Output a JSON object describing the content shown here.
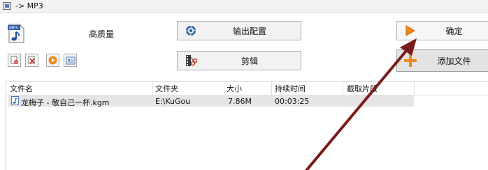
{
  "window": {
    "title": "-> MP3"
  },
  "format": {
    "icon_label": "MP3",
    "quality_label": "高质量"
  },
  "buttons": {
    "output_config": "输出配置",
    "edit": "剪辑",
    "ok": "确定",
    "add_file": "添加文件"
  },
  "toolbar": {
    "icons": [
      "remove-icon",
      "delete-icon",
      "play-icon",
      "info-icon"
    ]
  },
  "file_list": {
    "columns": [
      "文件名",
      "文件夹",
      "大小",
      "持续时间",
      "截取片段"
    ],
    "rows": [
      {
        "name": "龙梅子 - 敬自己一杯.kgm",
        "folder": "E:\\KuGou",
        "size": "7.86M",
        "duration": "00:03:25",
        "clip": ""
      }
    ]
  },
  "colors": {
    "arrow": "#7a1c1c",
    "selected_row": "#e5e5e5"
  }
}
